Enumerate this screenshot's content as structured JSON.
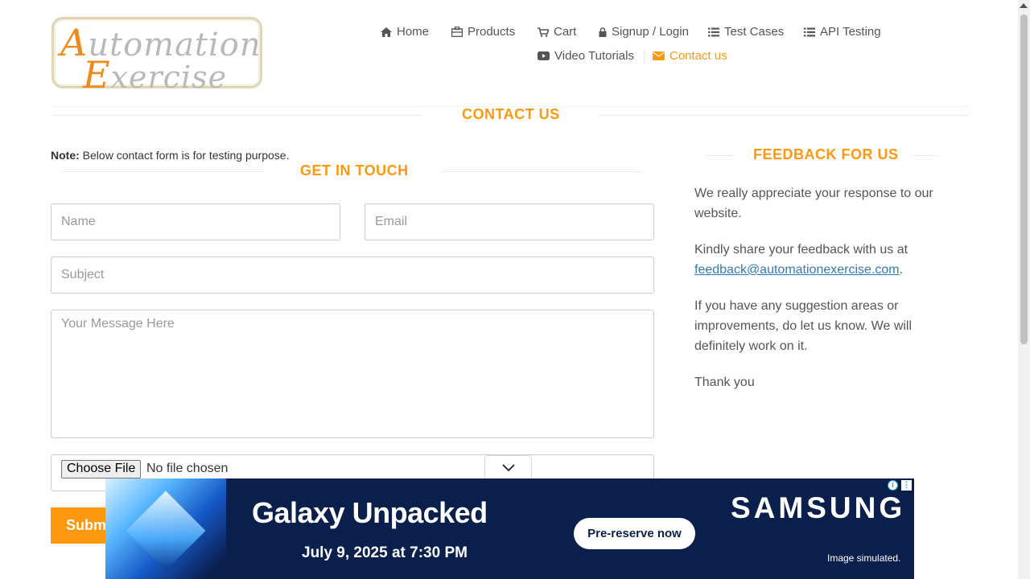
{
  "logo": {
    "line1": "Automation",
    "line2": "Exercise"
  },
  "nav": {
    "row1": [
      {
        "label": "Home",
        "icon": "home-icon"
      },
      {
        "label": "Products",
        "icon": "products-icon"
      },
      {
        "label": "Cart",
        "icon": "cart-icon"
      },
      {
        "label": "Signup / Login",
        "icon": "lock-icon"
      },
      {
        "label": "Test Cases",
        "icon": "list-icon"
      },
      {
        "label": "API Testing",
        "icon": "list-icon"
      }
    ],
    "row2": [
      {
        "label": "Video Tutorials",
        "icon": "youtube-icon"
      },
      {
        "label": "Contact us",
        "icon": "envelope-icon",
        "active": true
      }
    ]
  },
  "contact": {
    "heading": "CONTACT US",
    "note_label": "Note:",
    "note_text": " Below contact form is for testing purpose.",
    "form_heading": "GET IN TOUCH",
    "name_placeholder": "Name",
    "email_placeholder": "Email",
    "subject_placeholder": "Subject",
    "message_placeholder": "Your Message Here",
    "file_button": "Choose File",
    "file_status": "No file chosen",
    "submit_label": "Submit"
  },
  "feedback": {
    "heading": "FEEDBACK FOR US",
    "p1": "We really appreciate your response to our website.",
    "p2_text": "Kindly share your feedback with us at",
    "p2_email": "feedback@automationexercise.com",
    "p2_end": ".",
    "p3": "If you have any suggestion areas or improvements, do let us know. We will definitely work on it.",
    "p4": "Thank you"
  },
  "ad": {
    "title": "Galaxy Unpacked",
    "date": "July 9, 2025 at 7:30 PM",
    "cta": "Pre-reserve now",
    "brand": "SAMSUNG",
    "note": "Image simulated."
  },
  "colors": {
    "accent": "#fe980f",
    "link": "#337ab7",
    "ad_bg": "#0b1f4d"
  }
}
